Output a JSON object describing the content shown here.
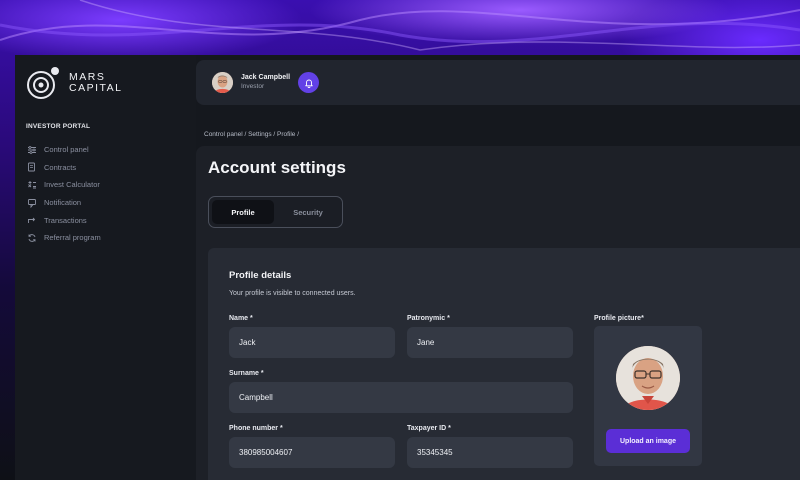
{
  "brand": {
    "line1": "MARS",
    "line2": "CAPITAL"
  },
  "sidebar": {
    "section_title": "INVESTOR PORTAL",
    "items": [
      {
        "label": "Control panel",
        "icon": "sliders-icon"
      },
      {
        "label": "Contracts",
        "icon": "document-icon"
      },
      {
        "label": "Invest Calculator",
        "icon": "calculator-icon"
      },
      {
        "label": "Notification",
        "icon": "message-icon"
      },
      {
        "label": "Transactions",
        "icon": "transfer-icon"
      },
      {
        "label": "Referral program",
        "icon": "refresh-icon"
      }
    ]
  },
  "header": {
    "user_name": "Jack Campbell",
    "user_role": "Investor"
  },
  "breadcrumb": "Control panel / Settings / Profile /",
  "page": {
    "title": "Account settings",
    "tabs": [
      {
        "label": "Profile",
        "active": true
      },
      {
        "label": "Security",
        "active": false
      }
    ]
  },
  "profile": {
    "title": "Profile details",
    "subtitle": "Your profile is visible to connected users.",
    "fields": {
      "name": {
        "label": "Name *",
        "value": "Jack"
      },
      "patronymic": {
        "label": "Patronymic *",
        "value": "Jane"
      },
      "surname": {
        "label": "Surname *",
        "value": "Campbell"
      },
      "phone": {
        "label": "Phone number *",
        "value": "380985004607"
      },
      "taxpayer": {
        "label": "Taxpayer ID *",
        "value": "35345345"
      }
    },
    "picture": {
      "label": "Profile picture*",
      "upload_label": "Upload an image"
    }
  },
  "colors": {
    "accent": "#5b2ed6",
    "bell": "#6241e6",
    "background": "#15181e",
    "card": "#272b34",
    "field": "#343944"
  }
}
